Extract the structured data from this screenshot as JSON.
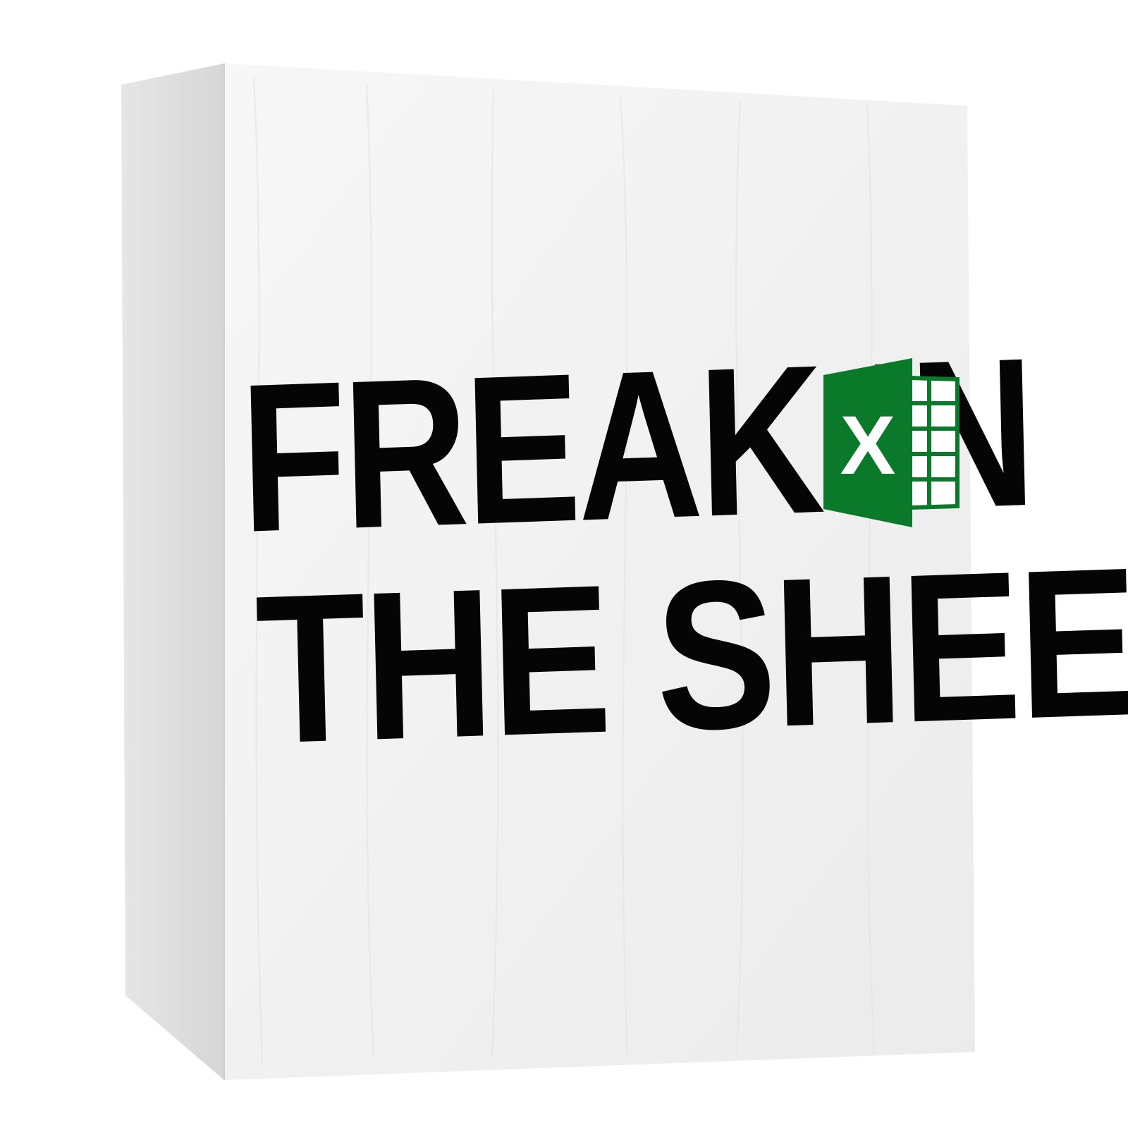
{
  "sign": {
    "line1": "FREAK IN",
    "line2": "THE SHEETS",
    "logo_letter": "X"
  },
  "colors": {
    "face": "#f2f2f2",
    "side": "#dcdcdc",
    "text": "#050505",
    "logo_green": "#0a7a2a"
  },
  "icons": {
    "logo": "spreadsheet-app-icon"
  }
}
